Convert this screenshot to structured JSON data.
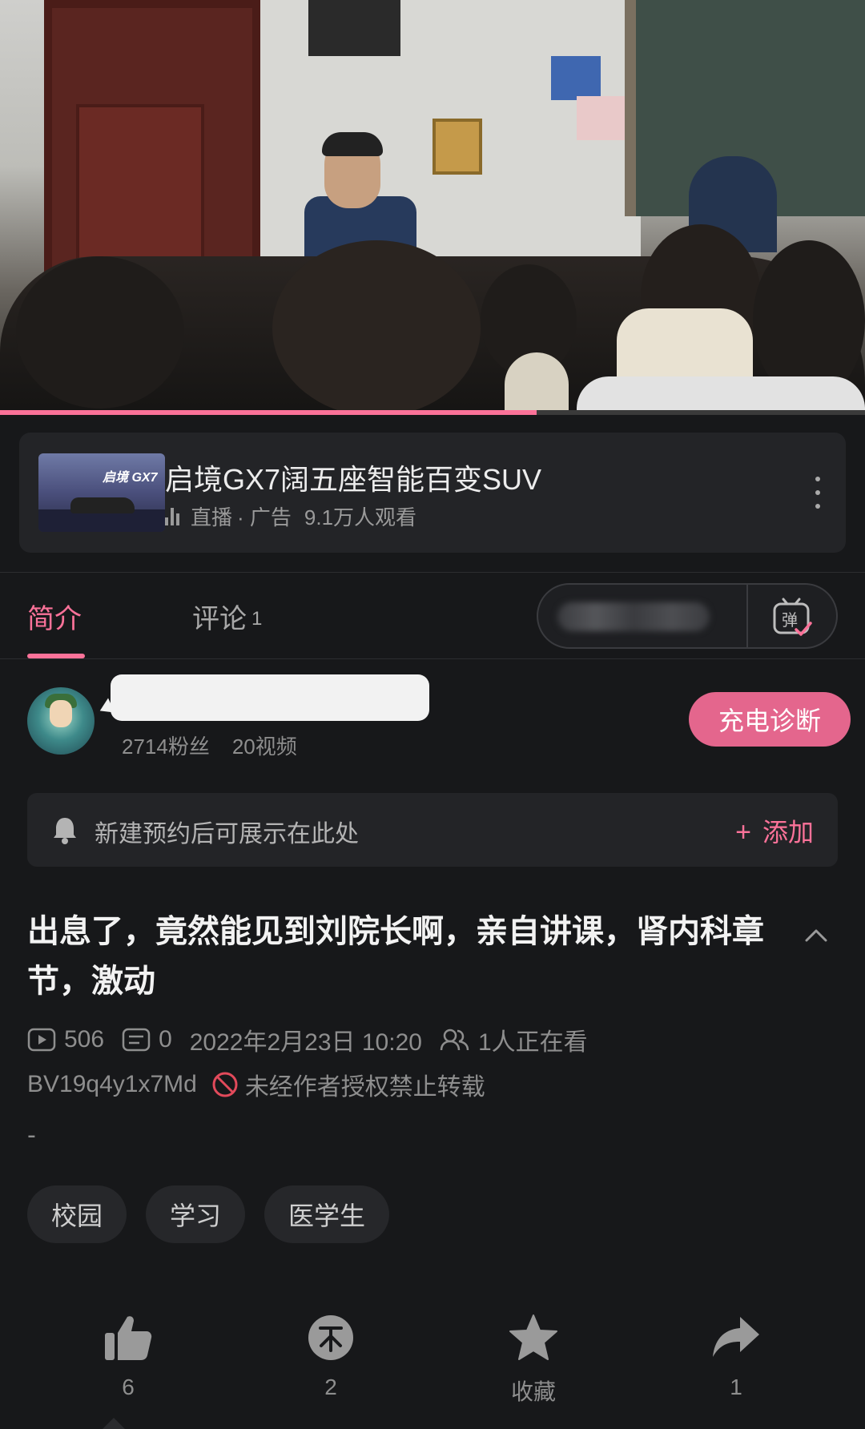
{
  "video": {
    "progress": 0.62
  },
  "ad": {
    "thumb_text": "启境 GX7",
    "title": "启境GX7阔五座智能百变SUV",
    "live_label": "直播",
    "ad_label": "· 广告",
    "views": "9.1万人观看"
  },
  "tabs": {
    "intro": "简介",
    "comments": "评论",
    "comments_count": "1"
  },
  "danmaku": {
    "icon": "danmaku-toggle-icon",
    "label": "弹"
  },
  "uploader": {
    "fans": "2714粉丝",
    "videos": "20视频",
    "charge_button": "充电诊断"
  },
  "reservation": {
    "text": "新建预约后可展示在此处",
    "add_label": "添加"
  },
  "video_info": {
    "title": "出息了，竟然能见到刘院长啊，亲自讲课，肾内科章节，激动",
    "plays": "506",
    "danmaku_count": "0",
    "datetime": "2022年2月23日 10:20",
    "watching": "1人正在看",
    "bvid": "BV19q4y1x7Md",
    "no_repost": "未经作者授权禁止转载",
    "description": "-"
  },
  "tags": [
    "校园",
    "学习",
    "医学生"
  ],
  "actions": {
    "like": "6",
    "coin": "2",
    "favorite": "收藏",
    "share": "1"
  },
  "colors": {
    "accent": "#fb7299",
    "background": "#17181a",
    "card": "#232427"
  }
}
